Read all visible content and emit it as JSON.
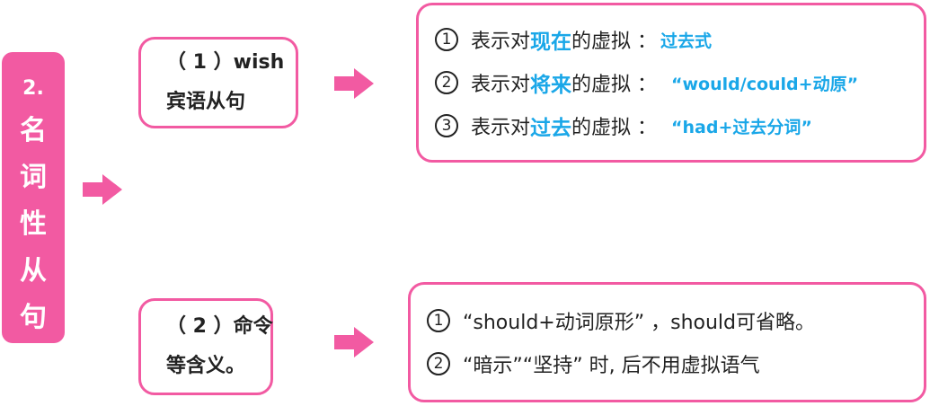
{
  "colors": {
    "accent": "#f25aa2",
    "highlight": "#1aa7e8",
    "text": "#222222"
  },
  "side_label": {
    "number": "2.",
    "chars": [
      "名",
      "词",
      "性",
      "从",
      "句"
    ]
  },
  "section1": {
    "title_line1": "（ 1 ）wish",
    "title_line2": "宾语从句",
    "items": [
      {
        "num": "1",
        "prefix": "表示对",
        "highlight": "现在",
        "suffix": "的虚拟 ：",
        "note": "过去式"
      },
      {
        "num": "2",
        "prefix": "表示对",
        "highlight": "将来",
        "suffix": "的虚拟 ：",
        "note": "“would/could+动原”"
      },
      {
        "num": "3",
        "prefix": "表示对",
        "highlight": "过去",
        "suffix": "的虚拟 ：",
        "note": "“had+过去分词”"
      }
    ]
  },
  "section2": {
    "title_line1": "（ 2 ）命令",
    "title_line2": "等含义。",
    "items": [
      {
        "num": "1",
        "text": "“should+动词原形” ，should可省略。"
      },
      {
        "num": "2",
        "text": "“暗示”“坚持” 时, 后不用虚拟语气"
      }
    ]
  }
}
